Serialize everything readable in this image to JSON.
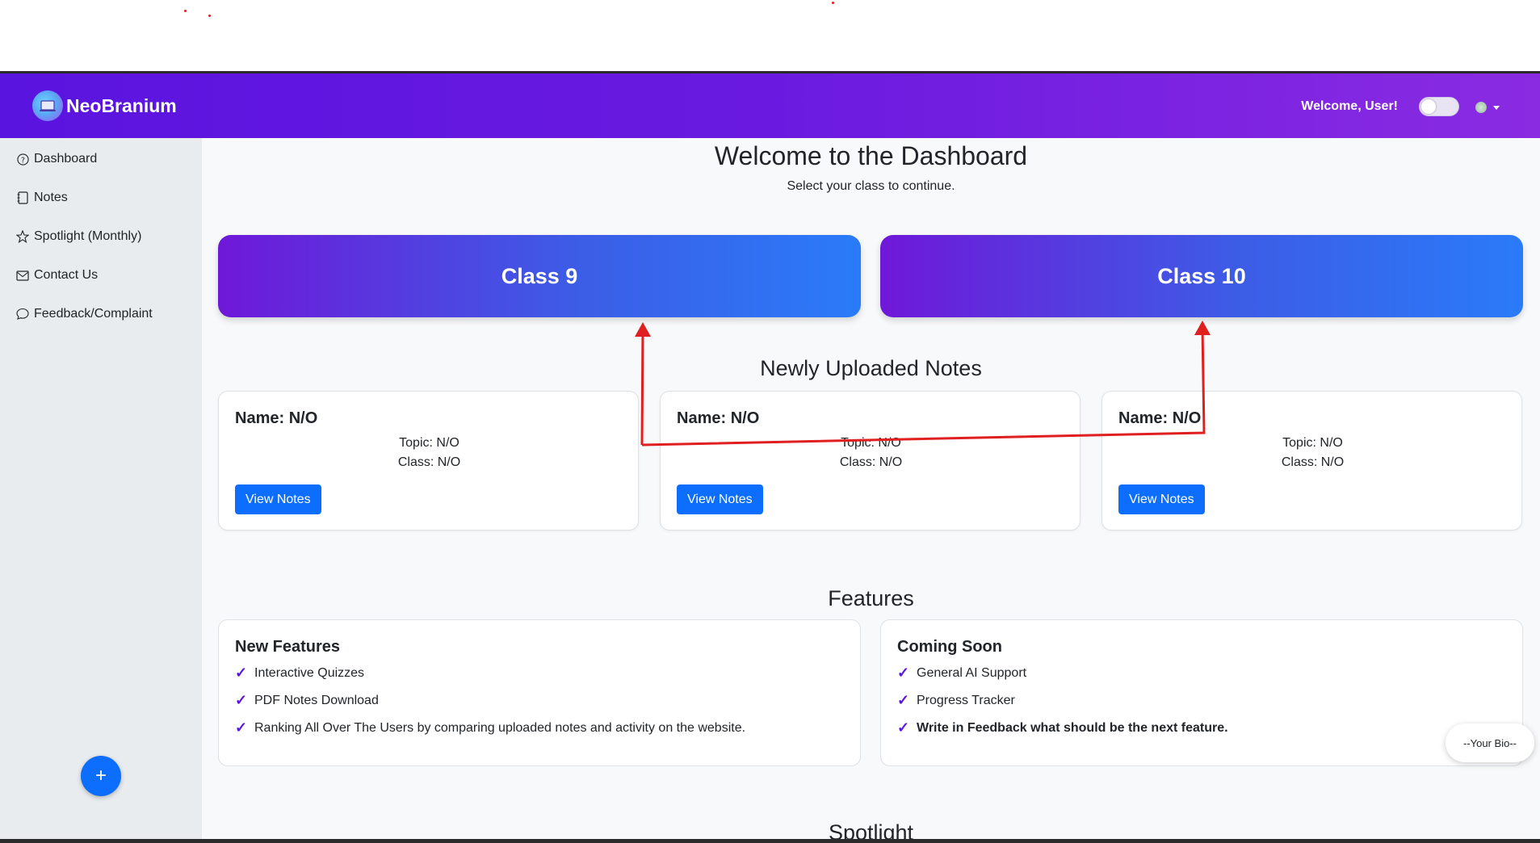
{
  "navbar": {
    "brand": "NeoBranium",
    "welcome": "Welcome, User!"
  },
  "sidebar": {
    "items": [
      {
        "label": "Dashboard",
        "icon": "question-circle-icon"
      },
      {
        "label": "Notes",
        "icon": "journal-icon"
      },
      {
        "label": "Spotlight (Monthly)",
        "icon": "star-icon"
      },
      {
        "label": "Contact Us",
        "icon": "envelope-icon"
      },
      {
        "label": "Feedback/Complaint",
        "icon": "chat-icon"
      }
    ],
    "fab": "+"
  },
  "main": {
    "title": "Welcome to the Dashboard",
    "subtitle": "Select your class to continue.",
    "classes": [
      "Class 9",
      "Class 10"
    ],
    "notes_heading": "Newly Uploaded Notes",
    "notes": [
      {
        "name": "Name: N/O",
        "topic": "Topic: N/O",
        "class": "Class: N/O",
        "button": "View Notes"
      },
      {
        "name": "Name: N/O",
        "topic": "Topic: N/O",
        "class": "Class: N/O",
        "button": "View Notes"
      },
      {
        "name": "Name: N/O",
        "topic": "Topic: N/O",
        "class": "Class: N/O",
        "button": "View Notes"
      }
    ],
    "features_heading": "Features",
    "features": [
      {
        "title": "New Features",
        "items": [
          "Interactive Quizzes",
          "PDF Notes Download",
          "Ranking All Over The Users by comparing uploaded notes and activity on the website."
        ]
      },
      {
        "title": "Coming Soon",
        "items": [
          "General AI Support",
          "Progress Tracker",
          "Write in Feedback what should be the next feature."
        ]
      }
    ],
    "spotlight_heading": "Spotlight"
  },
  "bio_button": "--Your Bio--",
  "colors": {
    "navbar_start": "#5a14df",
    "navbar_end": "#8a2be2",
    "primary": "#0d6efd",
    "annotation": "#e02020"
  }
}
